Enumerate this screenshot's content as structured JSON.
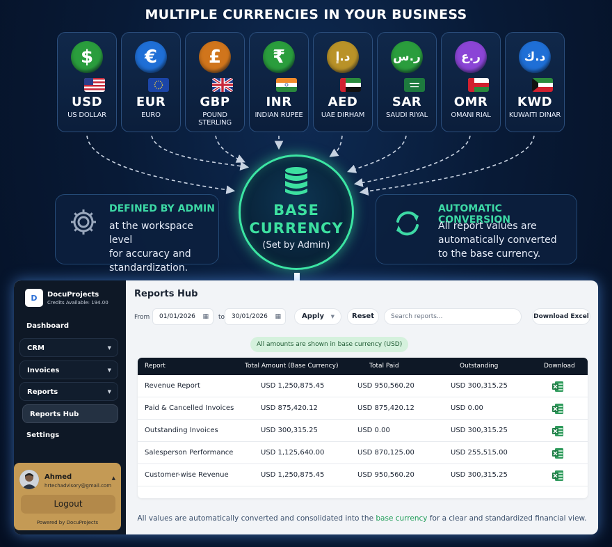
{
  "headline": "MULTIPLE CURRENCIES IN YOUR BUSINESS",
  "currencies": [
    {
      "symbol": "$",
      "code": "USD",
      "name": "US DOLLAR",
      "coin_color": "#2a9d3d",
      "flag": "us-flag-icon"
    },
    {
      "symbol": "€",
      "code": "EUR",
      "name": "EURO",
      "coin_color": "#1f6fd6",
      "flag": "eu-flag-icon"
    },
    {
      "symbol": "£",
      "code": "GBP",
      "name": "POUND STERLING",
      "coin_color": "#d0751c",
      "flag": "uk-flag-icon"
    },
    {
      "symbol": "₹",
      "code": "INR",
      "name": "INDIAN RUPEE",
      "coin_color": "#2a9d3d",
      "flag": "in-flag-icon"
    },
    {
      "symbol": "د.إ",
      "code": "AED",
      "name": "UAE DIRHAM",
      "coin_color": "#b99228",
      "flag": "ae-flag-icon"
    },
    {
      "symbol": "ر.س",
      "code": "SAR",
      "name": "SAUDI RIYAL",
      "coin_color": "#2a9d3d",
      "flag": "sa-flag-icon"
    },
    {
      "symbol": "ر.ع",
      "code": "OMR",
      "name": "OMANI RIAL",
      "coin_color": "#8b45d6",
      "flag": "om-flag-icon"
    },
    {
      "symbol": "د.ك",
      "code": "KWD",
      "name": "KUWAITI DINAR",
      "coin_color": "#1f6fd6",
      "flag": "kw-flag-icon"
    }
  ],
  "admin_card": {
    "title": "DEFINED BY ADMIN",
    "lines": [
      "at the workspace level",
      "for accuracy and",
      "standardization."
    ],
    "icon": "gear-icon"
  },
  "base": {
    "line1": "BASE",
    "line2": "CURRENCY",
    "sub": "(Set by Admin)",
    "icon": "database-icon"
  },
  "auto_card": {
    "title": "AUTOMATIC CONVERSION",
    "lines": [
      "All report values are",
      "automatically converted",
      "to the base currency."
    ],
    "icon": "refresh-icon"
  },
  "app": {
    "brand": {
      "name": "DocuProjects",
      "credits": "Credits Available: 194.00"
    },
    "nav": [
      {
        "label": "Dashboard"
      },
      {
        "label": "CRM"
      },
      {
        "label": "Invoices"
      },
      {
        "label": "Reports"
      },
      {
        "label": "Reports Hub"
      },
      {
        "label": "Settings"
      }
    ],
    "user": {
      "name": "Ahmed",
      "email": "hrtechadvisory@gmail.com",
      "logout": "Logout",
      "powered": "Powered by DocuProjects"
    },
    "title": "Reports Hub",
    "filters": {
      "from_label": "From",
      "from_date": "01/01/2026",
      "to_label": "to",
      "to_date": "30/01/2026",
      "apply": "Apply",
      "reset": "Reset",
      "search_placeholder": "Search reports...",
      "download_excel": "Download Excel"
    },
    "notice": "All amounts are shown in base currency (USD)",
    "table": {
      "headers": [
        "Report",
        "Total Amount (Base Currency)",
        "Total Paid",
        "Outstanding",
        "Download"
      ],
      "rows": [
        {
          "report": "Revenue Report",
          "total": "USD 1,250,875.45",
          "paid": "USD 950,560.20",
          "outstanding": "USD 300,315.25"
        },
        {
          "report": "Paid & Cancelled Invoices",
          "total": "USD 875,420.12",
          "paid": "USD 875,420.12",
          "outstanding": "USD 0.00"
        },
        {
          "report": "Outstanding Invoices",
          "total": "USD 300,315.25",
          "paid": "USD 0.00",
          "outstanding": "USD 300,315.25"
        },
        {
          "report": "Salesperson Performance",
          "total": "USD 1,125,640.00",
          "paid": "USD 870,125.00",
          "outstanding": "USD 255,515.00"
        },
        {
          "report": "Customer-wise Revenue",
          "total": "USD 1,250,875.45",
          "paid": "USD 950,560.20",
          "outstanding": "USD 300,315.25"
        }
      ]
    },
    "footer": {
      "before": "All values are automatically converted and consolidated into the ",
      "highlight": "base currency",
      "after": " for a clear and standardized financial view."
    }
  },
  "colors": {
    "accent_green": "#3de0a0",
    "navy": "#0e1826",
    "excel_green": "#1e7d45"
  }
}
